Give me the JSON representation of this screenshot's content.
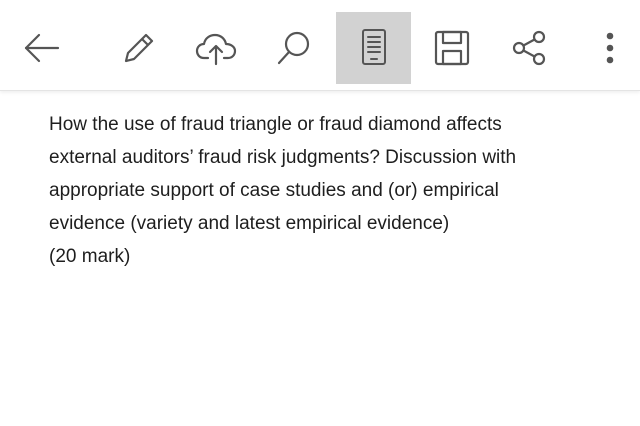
{
  "toolbar": {
    "buttons": [
      {
        "id": "back",
        "icon": "arrow-left-icon"
      },
      {
        "id": "edit",
        "icon": "pencil-icon"
      },
      {
        "id": "upload",
        "icon": "cloud-upload-icon"
      },
      {
        "id": "search",
        "icon": "search-icon"
      },
      {
        "id": "reading-mode",
        "icon": "reading-view-icon",
        "active": true
      },
      {
        "id": "save",
        "icon": "floppy-disk-icon"
      },
      {
        "id": "share",
        "icon": "share-icon"
      },
      {
        "id": "more",
        "icon": "more-vertical-icon"
      }
    ],
    "active_button_color": "#d2d2d2",
    "icon_color": "#555555"
  },
  "document": {
    "lines": [
      "How the use of fraud triangle or fraud diamond affects",
      "external auditors’ fraud risk judgments? Discussion with",
      "appropriate support of case studies and (or) empirical",
      "evidence (variety and latest empirical evidence)",
      "(20 mark)"
    ],
    "text_color": "#1e1e1e"
  }
}
